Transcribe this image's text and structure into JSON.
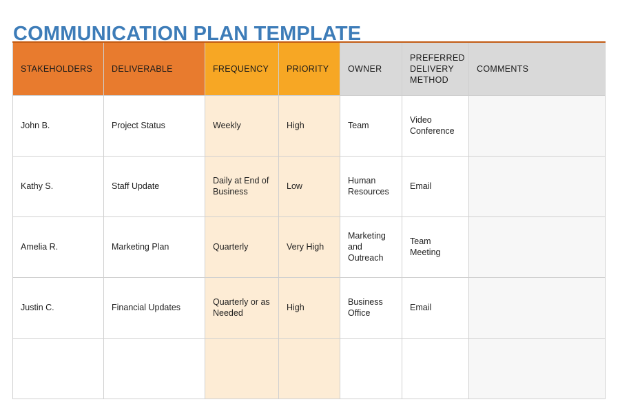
{
  "page": {
    "title": "COMMUNICATION PLAN TEMPLATE",
    "title_color": "#3d7cb8"
  },
  "theme": {
    "header_dark_orange": "#e87b2e",
    "header_amber": "#f7a724",
    "header_gray": "#d9d9d9",
    "body_peach": "#fdecd5",
    "body_gray": "#f7f7f7",
    "top_border": "#c25a12",
    "grid_line": "#d0d0d0"
  },
  "table": {
    "columns": [
      {
        "key": "stakeholders",
        "label": "STAKEHOLDERS",
        "header_style": "dark",
        "body_style": "plain"
      },
      {
        "key": "deliverable",
        "label": "DELIVERABLE",
        "header_style": "dark",
        "body_style": "plain"
      },
      {
        "key": "frequency",
        "label": "FREQUENCY",
        "header_style": "amber",
        "body_style": "peach"
      },
      {
        "key": "priority",
        "label": "PRIORITY",
        "header_style": "amber",
        "body_style": "peach"
      },
      {
        "key": "owner",
        "label": "OWNER",
        "header_style": "gray",
        "body_style": "plain"
      },
      {
        "key": "method",
        "label": "PREFERRED DELIVERY METHOD",
        "header_style": "gray",
        "body_style": "plain"
      },
      {
        "key": "comments",
        "label": "COMMENTS",
        "header_style": "gray",
        "body_style": "gray"
      }
    ],
    "rows": [
      {
        "stakeholders": "John B.",
        "deliverable": "Project Status",
        "frequency": "Weekly",
        "priority": "High",
        "owner": "Team",
        "method": "Video Conference",
        "comments": ""
      },
      {
        "stakeholders": "Kathy S.",
        "deliverable": "Staff Update",
        "frequency": "Daily at End of Business",
        "priority": "Low",
        "owner": "Human Resources",
        "method": "Email",
        "comments": ""
      },
      {
        "stakeholders": "Amelia R.",
        "deliverable": "Marketing Plan",
        "frequency": "Quarterly",
        "priority": "Very High",
        "owner": "Marketing and Outreach",
        "method": "Team Meeting",
        "comments": ""
      },
      {
        "stakeholders": "Justin C.",
        "deliverable": "Financial Updates",
        "frequency": "Quarterly or as Needed",
        "priority": "High",
        "owner": "Business Office",
        "method": "Email",
        "comments": ""
      },
      {
        "stakeholders": "",
        "deliverable": "",
        "frequency": "",
        "priority": "",
        "owner": "",
        "method": "",
        "comments": ""
      }
    ]
  }
}
